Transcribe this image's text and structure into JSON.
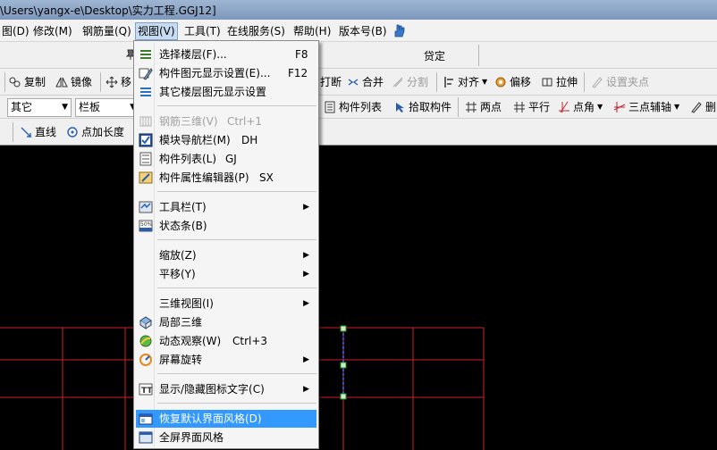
{
  "window": {
    "title": "\\Users\\yangx-e\\Desktop\\实力工程.GGJ12]"
  },
  "menubar": {
    "items": [
      "图(D)",
      "修改(M)",
      "钢筋量(Q)",
      "视图(V)",
      "工具(T)",
      "在线服务(S)",
      "帮助(H)",
      "版本号(B)"
    ]
  },
  "toolbar1": {
    "lock_label": "贷定"
  },
  "toolbar2": {
    "copy": "复制",
    "mirror": "镜像",
    "move": "移",
    "break": "打断",
    "merge": "合并",
    "split": "分割",
    "align": "对齐",
    "offset": "偏移",
    "stretch": "拉伸",
    "set_grip": "设置夹点"
  },
  "toolbar3": {
    "floor_select": "其它",
    "component_select": "栏板",
    "component_list": "构件列表",
    "pick_component": "拾取构件",
    "two_points": "两点",
    "parallel": "平行",
    "point_angle": "点角",
    "three_point_aux": "三点辅轴",
    "delete_aux": "删"
  },
  "toolbar4": {
    "line": "直线",
    "point_length": "点加长度"
  },
  "view_menu": {
    "items": [
      {
        "label": "选择楼层(F)...",
        "shortcut": "F8",
        "icon": "floor-select-icon"
      },
      {
        "label": "构件图元显示设置(E)...",
        "shortcut": "F12",
        "icon": "display-settings-icon"
      },
      {
        "label": "其它楼层图元显示设置",
        "shortcut": "",
        "icon": "other-floor-icon"
      },
      {
        "label": "钢筋三维(V)",
        "shortcut": "Ctrl+1",
        "icon": "rebar-3d-icon",
        "disabled": true
      },
      {
        "label": "模块导航栏(M)",
        "shortcut": "DH",
        "icon": "checkbox-checked-icon"
      },
      {
        "label": "构件列表(L)",
        "shortcut": "GJ",
        "icon": "list-icon"
      },
      {
        "label": "构件属性编辑器(P)",
        "shortcut": "SX",
        "icon": "property-editor-icon"
      },
      {
        "label": "工具栏(T)",
        "shortcut": "",
        "icon": "toolbar-icon",
        "submenu": true
      },
      {
        "label": "状态条(B)",
        "shortcut": "",
        "icon": "statusbar-icon"
      },
      {
        "label": "缩放(Z)",
        "shortcut": "",
        "submenu": true
      },
      {
        "label": "平移(Y)",
        "shortcut": "",
        "submenu": true
      },
      {
        "label": "三维视图(I)",
        "shortcut": "",
        "submenu": true
      },
      {
        "label": "局部三维",
        "shortcut": "",
        "icon": "partial-3d-icon"
      },
      {
        "label": "动态观察(W)",
        "shortcut": "Ctrl+3",
        "icon": "orbit-icon"
      },
      {
        "label": "屏幕旋转",
        "shortcut": "",
        "icon": "rotate-screen-icon",
        "submenu": true
      },
      {
        "label": "显示/隐藏图标文字(C)",
        "shortcut": "",
        "icon": "text-toggle-icon",
        "submenu": true
      },
      {
        "label": "恢复默认界面风格(D)",
        "shortcut": "",
        "icon": "restore-layout-icon",
        "highlighted": true
      },
      {
        "label": "全屏界面风格",
        "shortcut": "",
        "icon": "fullscreen-icon"
      }
    ]
  },
  "colors": {
    "grid_line": "#d0202a",
    "menu_highlight": "#3399ff",
    "canvas": "#000000"
  }
}
